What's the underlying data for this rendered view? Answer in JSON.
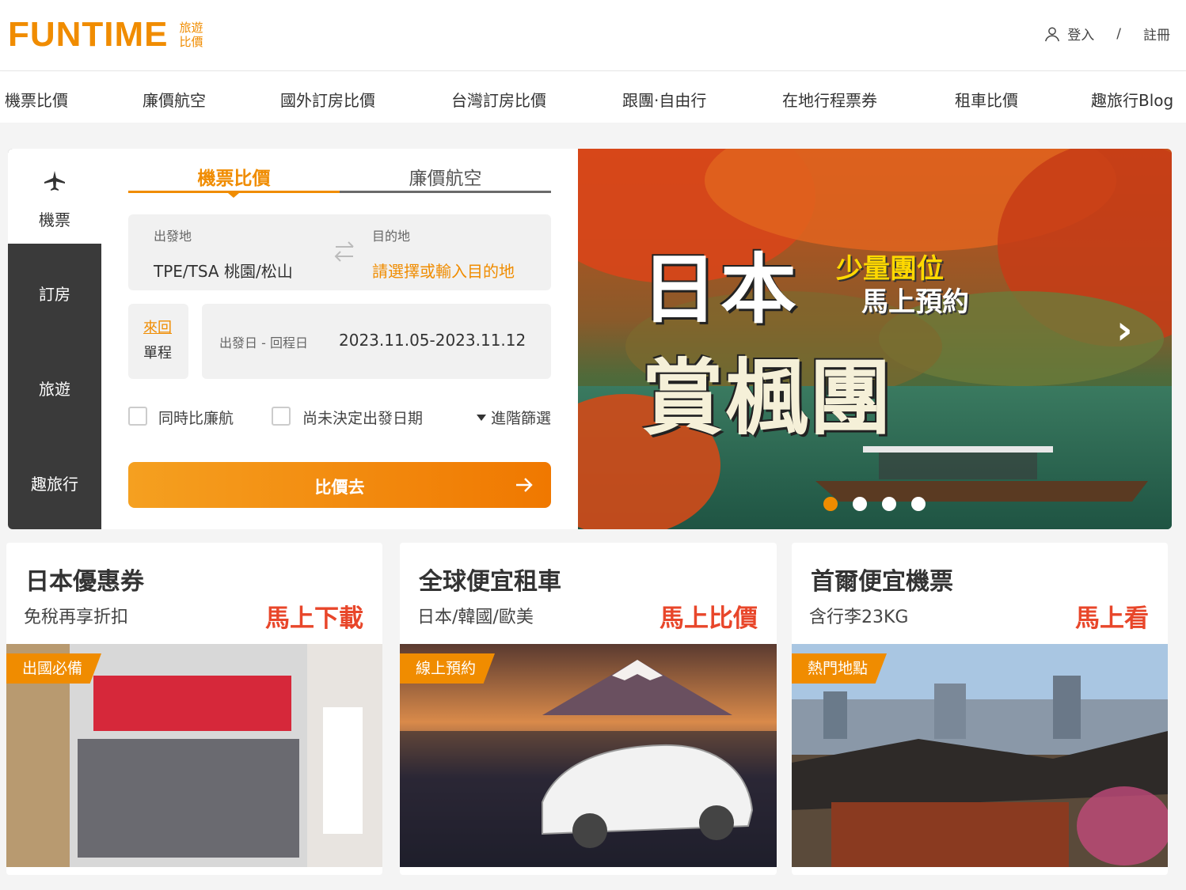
{
  "header": {
    "logo": "FUNTIME",
    "logo_sub_1": "旅遊",
    "logo_sub_2": "比價",
    "login": "登入",
    "separator": "/",
    "register": "註冊"
  },
  "nav": [
    "機票比價",
    "廉價航空",
    "國外訂房比價",
    "台灣訂房比價",
    "跟團·自由行",
    "在地行程票券",
    "租車比價",
    "趣旅行Blog"
  ],
  "sidebar": {
    "active": "機票",
    "items": [
      "訂房",
      "旅遊",
      "趣旅行"
    ]
  },
  "search": {
    "tabs": [
      "機票比價",
      "廉價航空"
    ],
    "origin_label": "出發地",
    "origin_value": "TPE/TSA 桃園/松山",
    "dest_label": "目的地",
    "dest_placeholder": "請選擇或輸入目的地",
    "trip_roundtrip": "來回",
    "trip_oneway": "單程",
    "date_label": "出發日 - 回程日",
    "date_value": "2023.11.05-2023.11.12",
    "opt_compare_lcc": "同時比廉航",
    "opt_undecided": "尚未決定出發日期",
    "advanced": "進階篩選",
    "submit": "比價去"
  },
  "banner": {
    "title_1": "日本",
    "title_2": "賞楓團",
    "tag_1": "少量團位",
    "tag_2": "馬上預約",
    "next": "›",
    "slides": 4,
    "active_slide": 1
  },
  "promos": [
    {
      "title": "日本優惠券",
      "subtitle": "免稅再享折扣",
      "cta": "馬上下載",
      "ribbon": "出國必備"
    },
    {
      "title": "全球便宜租車",
      "subtitle": "日本/韓國/歐美",
      "cta": "馬上比價",
      "ribbon": "線上預約"
    },
    {
      "title": "首爾便宜機票",
      "subtitle": "含行李23KG",
      "cta": "馬上看",
      "ribbon": "熱門地點"
    }
  ],
  "colors": {
    "accent": "#f08c00",
    "cta_red": "#e8462a",
    "sidebar": "#3a3a3a"
  }
}
